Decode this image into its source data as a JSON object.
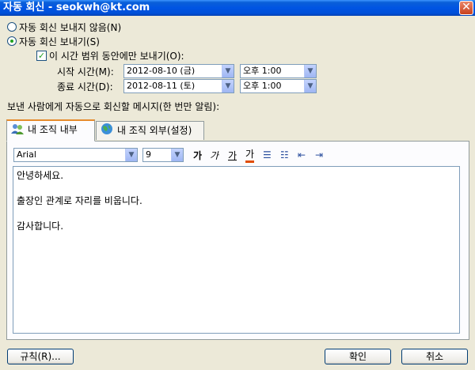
{
  "window": {
    "title": "자동 회신 - seokwh@kt.com",
    "close_glyph": "✕"
  },
  "options": {
    "no_reply_label": "자동 회신 보내지 않음(N)",
    "send_reply_label": "자동 회신 보내기(S)",
    "time_range_label": "이 시간 범위 동안에만 보내기(O):",
    "start_label": "시작 시간(M):",
    "end_label": "종료 시간(D):",
    "start_date": "2012-08-10 (금)",
    "start_time": "오후 1:00",
    "end_date": "2012-08-11 (토)",
    "end_time": "오후 1:00",
    "selected": "send",
    "time_range_checked": true
  },
  "message_label": "보낸 사람에게 자동으로 회신할 메시지(한 번만 알림):",
  "tabs": [
    {
      "label": "내 조직 내부",
      "active": true
    },
    {
      "label": "내 조직 외부(설정)",
      "active": false
    }
  ],
  "format": {
    "font": "Arial",
    "size": "9",
    "bold": "가",
    "italic": "가",
    "underline": "가",
    "color": "가",
    "bullets": "☰",
    "numbering": "☷",
    "decrease_indent": "⇤",
    "increase_indent": "⇥"
  },
  "editor_lines": [
    "안녕하세요.",
    "",
    "출장인 관계로 자리를 비웁니다.",
    "",
    "감사합니다."
  ],
  "buttons": {
    "rules": "규칙(R)...",
    "ok": "확인",
    "cancel": "취소"
  },
  "dropdown_glyph": "▼",
  "colors": {
    "title_bar": "#0054e3",
    "tab_accent": "#e68b2c",
    "font_color_underline": "#e04c00"
  }
}
